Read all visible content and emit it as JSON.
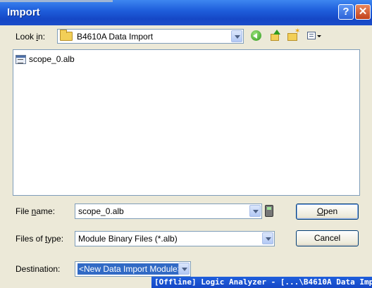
{
  "window": {
    "title": "Import",
    "help_label": "?",
    "close_label": "✕"
  },
  "look_in": {
    "label_prefix": "Look ",
    "label_accel": "i",
    "label_suffix": "n:",
    "value": "B4610A Data Import"
  },
  "toolbar": {
    "icons": [
      "back-icon",
      "up-folder-icon",
      "new-folder-icon",
      "views-menu-icon"
    ]
  },
  "file_list": {
    "items": [
      {
        "name": "scope_0.alb",
        "icon": "module-file-icon"
      }
    ]
  },
  "file_name": {
    "label_prefix": "File ",
    "label_accel": "n",
    "label_suffix": "ame:",
    "value": "scope_0.alb"
  },
  "file_type": {
    "label_prefix": "Files of ",
    "label_accel": "t",
    "label_suffix": "ype:",
    "value": "Module Binary Files (*.alb)"
  },
  "destination": {
    "label": "Destination:",
    "value": "<New Data Import Module>"
  },
  "buttons": {
    "open_accel": "O",
    "open_rest": "pen",
    "cancel": "Cancel"
  },
  "background_window": {
    "title": "[Offline] Logic Analyzer - [...\\B4610A Data Imp"
  },
  "colors": {
    "titlebar": "#1f5fdc",
    "dialog_bg": "#ece9d8",
    "selection": "#316ac5"
  }
}
